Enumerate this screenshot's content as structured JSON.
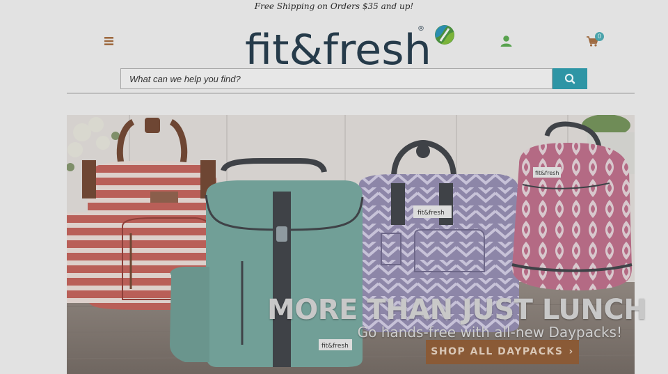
{
  "promo_bar": {
    "text": "Free Shipping on Orders $35 and up!"
  },
  "header": {
    "logo_text": "fit&fresh",
    "logo_mark": "®",
    "menu_icon": "hamburger-menu-icon",
    "account_icon": "user-icon",
    "cart_icon": "shopping-cart-icon",
    "cart_count": "0"
  },
  "search": {
    "placeholder": "What can we help you find?",
    "button_icon": "search-icon"
  },
  "hero": {
    "title": "MORE THAN JUST LUNCH",
    "subtitle": "Go hands-free with all-new Daypacks!",
    "cta_label": "SHOP ALL DAYPACKS",
    "cta_icon": "chevron-right-icon",
    "bag_labels": [
      "fit&fresh",
      "fit&fresh",
      "fit&fresh"
    ]
  },
  "colors": {
    "logo_text": "#263b4a",
    "accent_teal": "#2e95a5",
    "icon_orange": "#c1763b",
    "icon_green": "#58a24e",
    "cta_bg": "#8a5a36"
  }
}
